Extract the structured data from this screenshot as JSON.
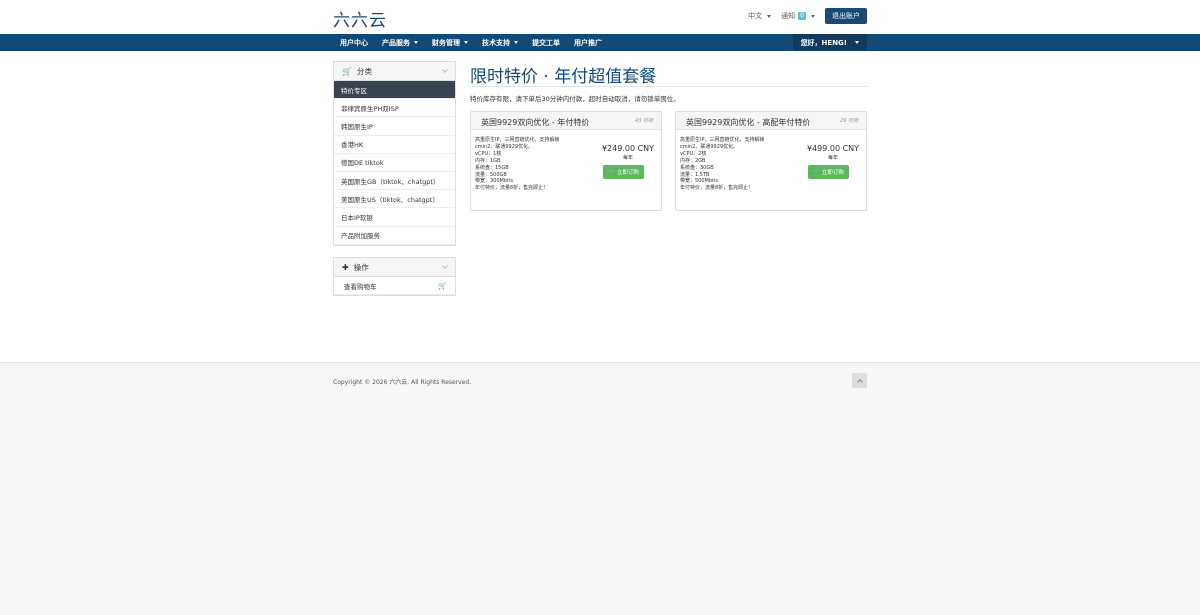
{
  "header": {
    "logo": "六六云",
    "language": "中文",
    "notifications_label": "通知",
    "notifications_count": "0",
    "logout": "退出账户"
  },
  "nav": {
    "items": [
      {
        "label": "用户中心",
        "dropdown": false
      },
      {
        "label": "产品服务",
        "dropdown": true
      },
      {
        "label": "财务管理",
        "dropdown": true
      },
      {
        "label": "技术支持",
        "dropdown": true
      },
      {
        "label": "提交工单",
        "dropdown": false
      },
      {
        "label": "用户推广",
        "dropdown": false
      }
    ],
    "user": "您好，HENG!"
  },
  "sidebar": {
    "categories_title": "分类",
    "categories": [
      "特价专区",
      "菲律宾原生PH双ISP",
      "韩国原生IP",
      "香港HK",
      "德国DE tiktok",
      "英国原生GB（tiktok、chatgpt）",
      "美国原生US（tiktok、chatgpt）",
      "日本IP软银",
      "产品附加服务"
    ],
    "active_index": 0,
    "actions_title": "操作",
    "actions": [
      "查看购物车"
    ]
  },
  "main": {
    "title": "限时特价 · 年付超值套餐",
    "notice": "特价库存有限，请下单后30分钟内付款，超时自动取消，请勿锁单囤位。",
    "products": [
      {
        "name": "英国9929双向优化 - 年付特价",
        "stock": "43 可用",
        "desc": [
          "高重原生IP，三网直链优化，支持解锁",
          "cmin2、联通9929优化。",
          "vCPU：1核",
          "内存：1GB",
          "系统盘：15GB",
          "流量：500GB",
          "带宽：300Mbits",
          "年付特价，流量8折，售完即止！"
        ],
        "price": "¥249.00 CNY",
        "cycle": "每年",
        "order_label": "立即订购"
      },
      {
        "name": "英国9929双向优化 - 高配年付特价",
        "stock": "29 可用",
        "desc": [
          "高重原生IP，三网直链优化，支持解锁",
          "cmin2、联通9929优化。",
          "vCPU：2核",
          "内存：2GB",
          "系统盘：30GB",
          "流量：1.5TB",
          "带宽：500Mbits",
          "年付特价，流量8折，售完即止！"
        ],
        "price": "¥499.00 CNY",
        "cycle": "每年",
        "order_label": "立即订购"
      }
    ]
  },
  "footer": {
    "copyright": "Copyright © 2026 六六云. All Rights Reserved."
  }
}
